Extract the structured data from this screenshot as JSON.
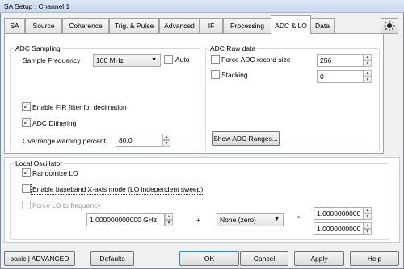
{
  "window": {
    "title": "SA Setup : Channel 1"
  },
  "tabs": [
    {
      "label": "SA"
    },
    {
      "label": "Source"
    },
    {
      "label": "Coherence"
    },
    {
      "label": "Trig. & Pulse"
    },
    {
      "label": "Advanced"
    },
    {
      "label": "IF"
    },
    {
      "label": "Processing"
    },
    {
      "label": "ADC & LO",
      "active": true
    },
    {
      "label": "Data"
    }
  ],
  "adc_sampling": {
    "title": "ADC Sampling",
    "sample_frequency_label": "Sample Frequency",
    "sample_frequency_value": "100 MHz",
    "auto_label": "Auto",
    "auto_checked": false,
    "fir_label": "Enable FIR filter for decimation",
    "fir_checked": true,
    "dithering_label": "ADC Dithering",
    "dithering_checked": true,
    "overrange_label": "Overrange warning percent",
    "overrange_value": "80.0"
  },
  "adc_raw": {
    "title": "ADC Raw data",
    "force_label": "Force ADC record size",
    "force_checked": false,
    "force_value": "256",
    "stacking_label": "Stacking",
    "stacking_checked": false,
    "stacking_value": "0",
    "show_ranges_label": "Show ADC Ranges..."
  },
  "local_oscillator": {
    "title": "Local Oscillator",
    "randomize_label": "Randomize LO",
    "randomize_checked": true,
    "baseband_label": "Enable baseband X-axis mode (LO independent sweep)",
    "baseband_checked": false,
    "force_lo_label": "Force LO to frequency",
    "force_lo_checked": false,
    "frequency_value": "1.000000000000 GHz",
    "plus_sign": "+",
    "offset_value": "None (zero)",
    "times_sign": "*",
    "numerator_value": "1.0000000000",
    "denominator_value": "1.0000000000"
  },
  "footer": {
    "mode_label": "basic | ADVANCED",
    "defaults_label": "Defaults",
    "ok_label": "OK",
    "cancel_label": "Cancel",
    "apply_label": "Apply",
    "help_label": "Help"
  },
  "icons": {
    "brightness": "sun-icon",
    "check": "✓"
  }
}
